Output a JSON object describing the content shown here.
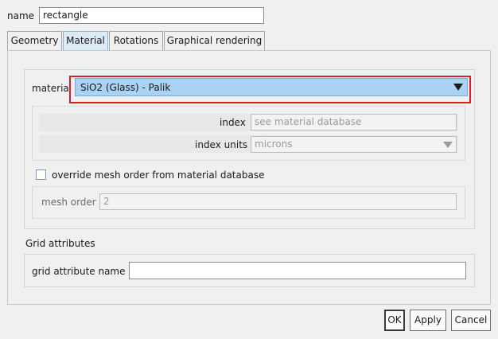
{
  "name_field": {
    "label": "name",
    "value": "rectangle"
  },
  "tabs": [
    {
      "label": "Geometry",
      "active": false
    },
    {
      "label": "Material",
      "active": true
    },
    {
      "label": "Rotations",
      "active": false
    },
    {
      "label": "Graphical rendering",
      "active": false
    }
  ],
  "material": {
    "label": "material",
    "selected": "SiO2 (Glass) - Palik",
    "highlight_color": "#d9202a",
    "select_color": "#a9d2f3"
  },
  "index": {
    "label": "index",
    "placeholder": "see material database"
  },
  "index_units": {
    "label": "index units",
    "selected": "microns"
  },
  "override": {
    "label": "override mesh order from material database",
    "checked": false
  },
  "mesh_order": {
    "label": "mesh order",
    "value": "2"
  },
  "grid": {
    "section_title": "Grid attributes",
    "name_label": "grid attribute name",
    "name_value": ""
  },
  "buttons": {
    "ok": "OK",
    "apply": "Apply",
    "cancel": "Cancel"
  }
}
